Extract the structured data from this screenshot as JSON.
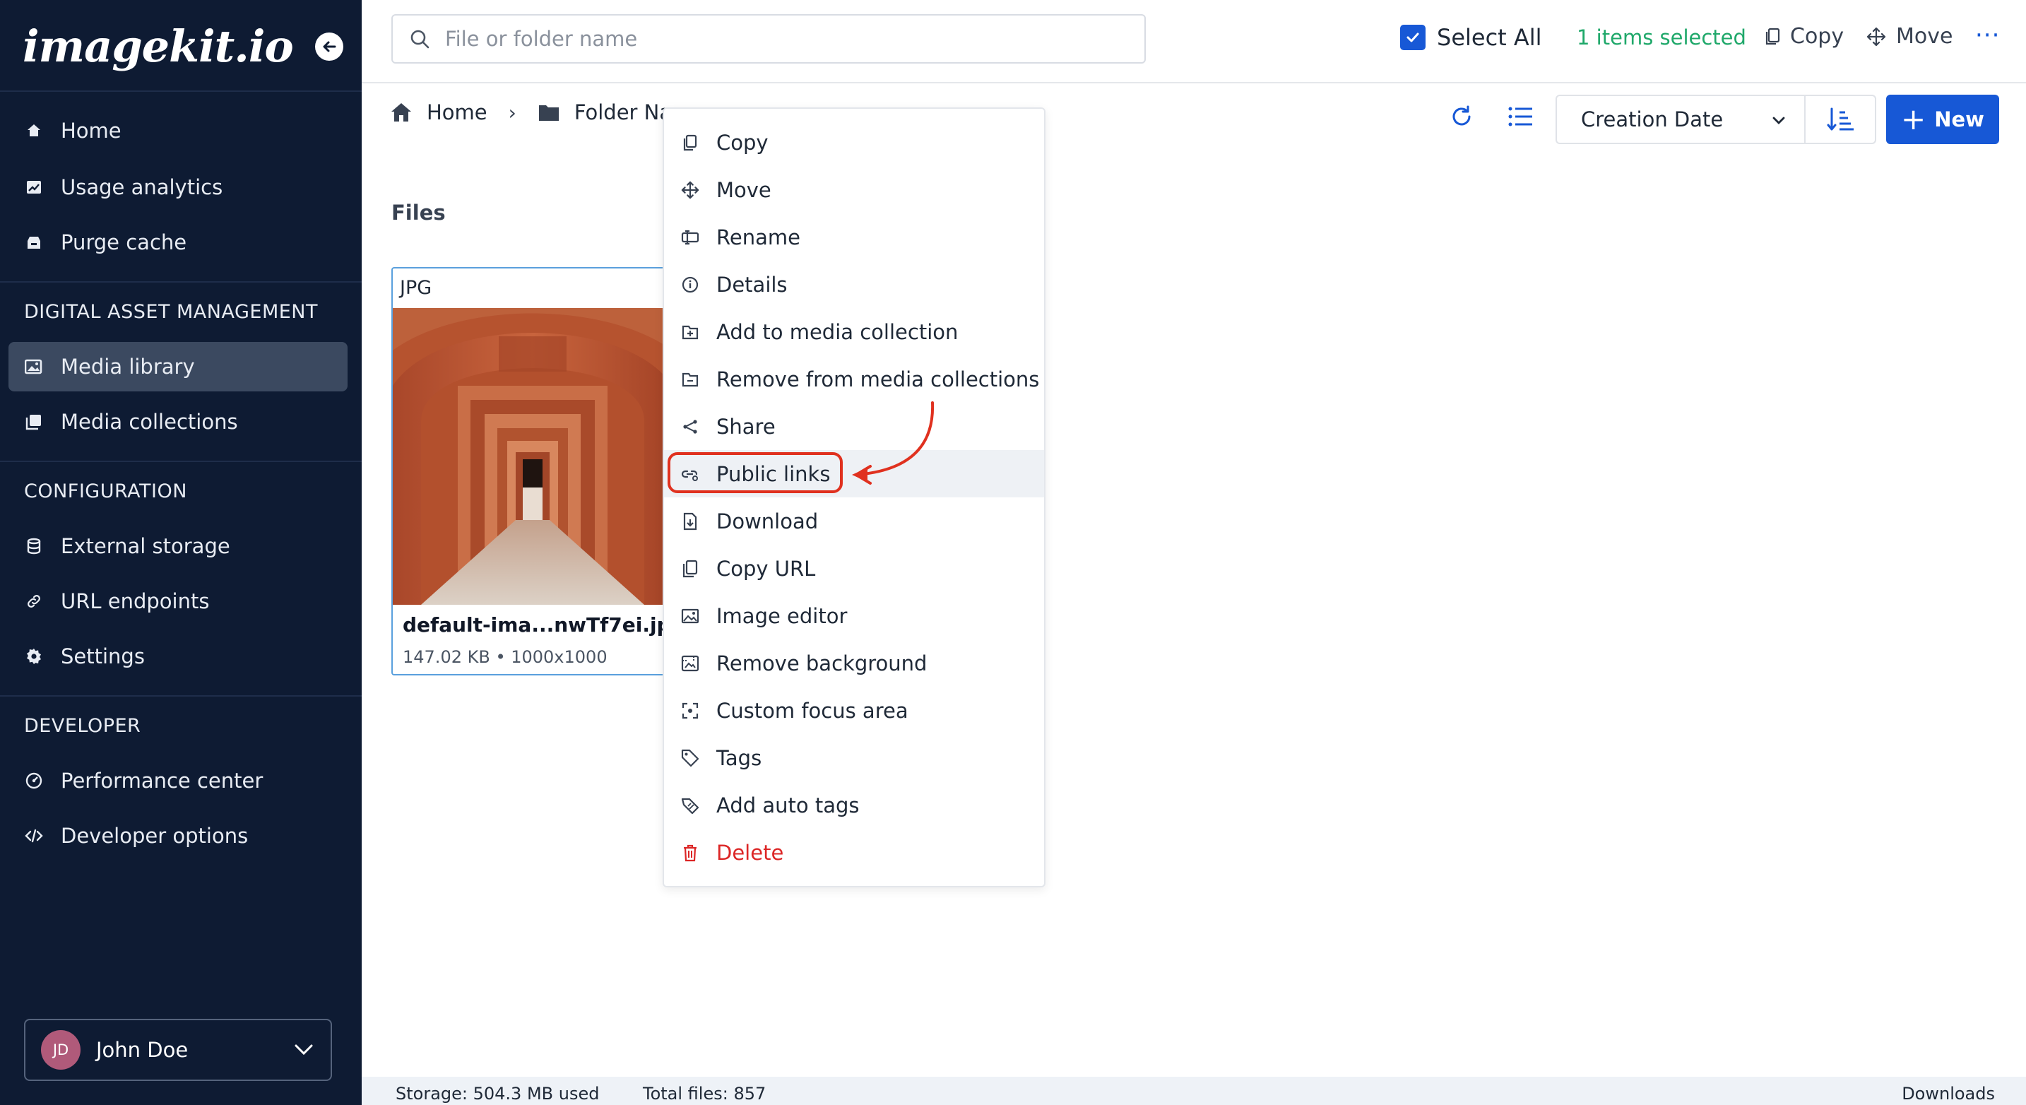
{
  "brand": {
    "logo_text": "imagekit.io"
  },
  "sidebar": {
    "items_top": [
      {
        "label": "Home",
        "icon": "home-icon"
      },
      {
        "label": "Usage analytics",
        "icon": "analytics-icon"
      },
      {
        "label": "Purge cache",
        "icon": "purge-icon"
      }
    ],
    "sections": {
      "dam": "DIGITAL ASSET MANAGEMENT",
      "config": "CONFIGURATION",
      "developer": "DEVELOPER"
    },
    "items_dam": [
      {
        "label": "Media library",
        "icon": "media-library-icon",
        "active": true
      },
      {
        "label": "Media collections",
        "icon": "media-collections-icon"
      }
    ],
    "items_config": [
      {
        "label": "External storage",
        "icon": "storage-icon"
      },
      {
        "label": "URL endpoints",
        "icon": "link-icon"
      },
      {
        "label": "Settings",
        "icon": "gear-icon"
      }
    ],
    "items_dev": [
      {
        "label": "Performance center",
        "icon": "performance-icon"
      },
      {
        "label": "Developer options",
        "icon": "code-icon"
      }
    ],
    "user": {
      "initials": "JD",
      "name": "John Doe"
    }
  },
  "topbar": {
    "search_placeholder": "File or folder name",
    "select_all_label": "Select All",
    "selected_count": "1 items selected",
    "copy_label": "Copy",
    "move_label": "Move",
    "more_label": "···"
  },
  "breadcrumb": {
    "home": "Home",
    "separator": "›",
    "folder": "Folder Na"
  },
  "toolbar": {
    "sort_label": "Creation Date",
    "new_label": "New"
  },
  "files": {
    "heading": "Files",
    "items": [
      {
        "type": "JPG",
        "name": "default-ima...nwTf7ei.jpg",
        "meta": "147.02 KB • 1000x1000"
      }
    ]
  },
  "context_menu": {
    "items": [
      {
        "label": "Copy",
        "icon": "copy-icon"
      },
      {
        "label": "Move",
        "icon": "move-icon"
      },
      {
        "label": "Rename",
        "icon": "rename-icon"
      },
      {
        "label": "Details",
        "icon": "info-icon"
      },
      {
        "label": "Add to media collection",
        "icon": "add-collection-icon"
      },
      {
        "label": "Remove from media collections",
        "icon": "remove-collection-icon"
      },
      {
        "label": "Share",
        "icon": "share-icon"
      },
      {
        "label": "Public links",
        "icon": "public-link-icon",
        "highlighted": true
      },
      {
        "label": "Download",
        "icon": "download-icon"
      },
      {
        "label": "Copy URL",
        "icon": "copy-url-icon"
      },
      {
        "label": "Image editor",
        "icon": "image-editor-icon"
      },
      {
        "label": "Remove background",
        "icon": "remove-bg-icon"
      },
      {
        "label": "Custom focus area",
        "icon": "focus-icon"
      },
      {
        "label": "Tags",
        "icon": "tag-icon"
      },
      {
        "label": "Add auto tags",
        "icon": "auto-tag-icon"
      },
      {
        "label": "Delete",
        "icon": "trash-icon",
        "danger": true
      }
    ]
  },
  "statusbar": {
    "storage": "Storage: 504.3 MB used",
    "total_files": "Total files: 857",
    "downloads": "Downloads"
  },
  "colors": {
    "sidebar_bg": "#0e1b33",
    "accent": "#1758d6",
    "success": "#1fa86a",
    "danger": "#dc2626",
    "annotation": "#e0311f"
  }
}
